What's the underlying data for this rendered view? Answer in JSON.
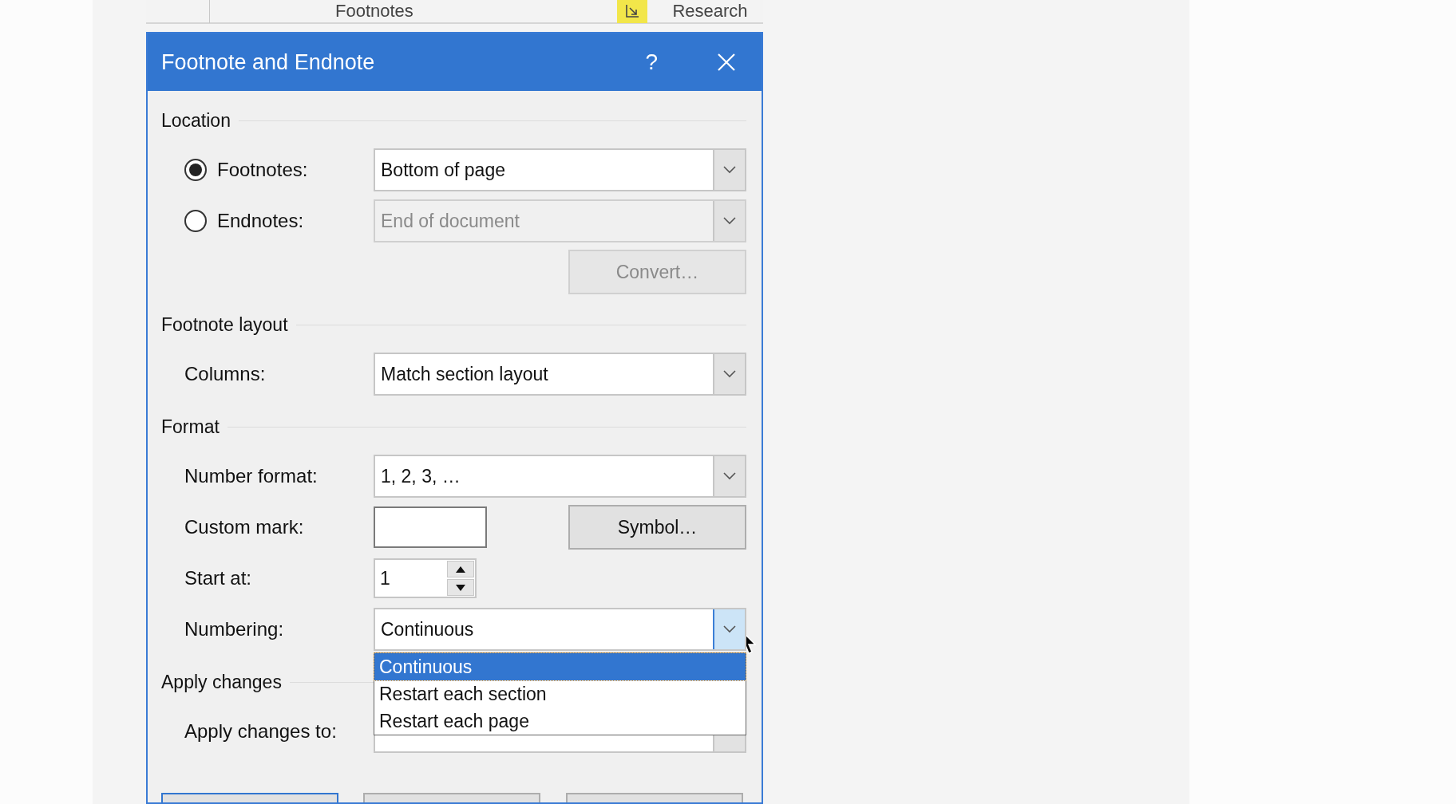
{
  "ribbon": {
    "groups": [
      {
        "label": "Footnotes"
      },
      {
        "label": "Research"
      }
    ],
    "launcher_highlighted": true
  },
  "dialog": {
    "title": "Footnote and Endnote",
    "help": "?",
    "sections": [
      {
        "heading": "Location",
        "rows": [
          {
            "kind": "radio",
            "label": "Footnotes:",
            "selected": true,
            "value": "Bottom of page",
            "disabled": false
          },
          {
            "kind": "radio",
            "label": "Endnotes:",
            "selected": false,
            "value": "End of document",
            "disabled": true
          },
          {
            "kind": "button",
            "label": "Convert…",
            "disabled": true
          }
        ]
      },
      {
        "heading": "Footnote layout",
        "rows": [
          {
            "kind": "combo",
            "label": "Columns:",
            "value": "Match section layout",
            "open": false
          }
        ]
      },
      {
        "heading": "Format",
        "rows": [
          {
            "kind": "combo",
            "label": "Number format:",
            "value": "1, 2, 3, …",
            "open": false
          },
          {
            "kind": "text",
            "label": "Custom mark:",
            "button": "Symbol…"
          },
          {
            "kind": "spinner",
            "label": "Start at:",
            "value": "1"
          },
          {
            "kind": "combo",
            "label": "Numbering:",
            "value": "Continuous",
            "open": true,
            "options": [
              {
                "label": "Continuous",
                "selected": true
              },
              {
                "label": "Restart each section",
                "selected": false
              },
              {
                "label": "Restart each page",
                "selected": false
              }
            ]
          }
        ]
      },
      {
        "heading": "Apply changes",
        "rows": [
          {
            "kind": "combo",
            "label": "Apply changes to:",
            "open": false
          }
        ]
      }
    ],
    "buttons": [
      {
        "default": true
      },
      {
        "default": false
      },
      {
        "default": false
      }
    ]
  }
}
